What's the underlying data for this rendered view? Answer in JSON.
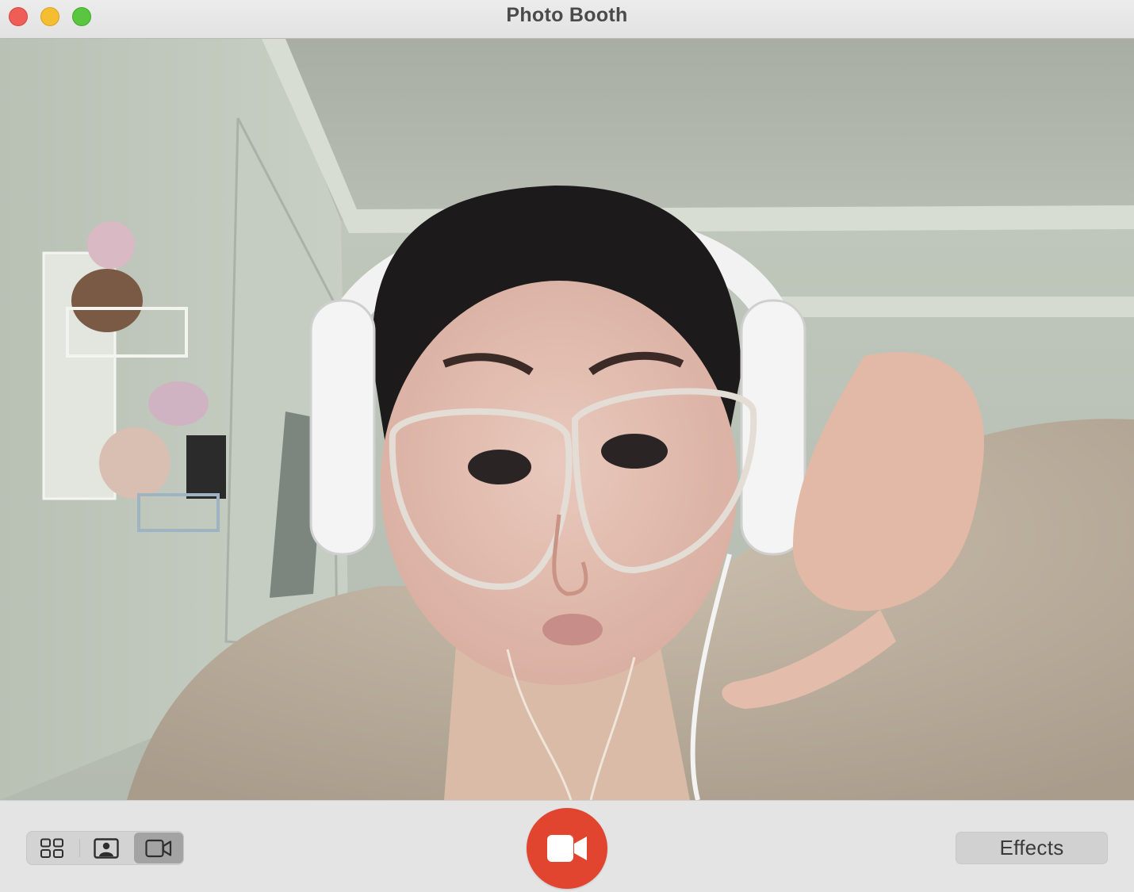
{
  "window": {
    "title": "Photo Booth"
  },
  "titlebar": {
    "buttons": [
      {
        "name": "close",
        "color": "#ee5e57"
      },
      {
        "name": "minimize",
        "color": "#f5bd30"
      },
      {
        "name": "zoom",
        "color": "#5ac53f"
      }
    ]
  },
  "toolbar": {
    "modes": [
      {
        "name": "four-up-photo",
        "icon": "grid-icon",
        "selected": false
      },
      {
        "name": "single-photo",
        "icon": "portrait-icon",
        "selected": false
      },
      {
        "name": "video",
        "icon": "video-camera-icon",
        "selected": true
      }
    ],
    "record_button": {
      "icon": "video-camera-icon",
      "color": "#e2452f"
    },
    "effects_label": "Effects"
  }
}
